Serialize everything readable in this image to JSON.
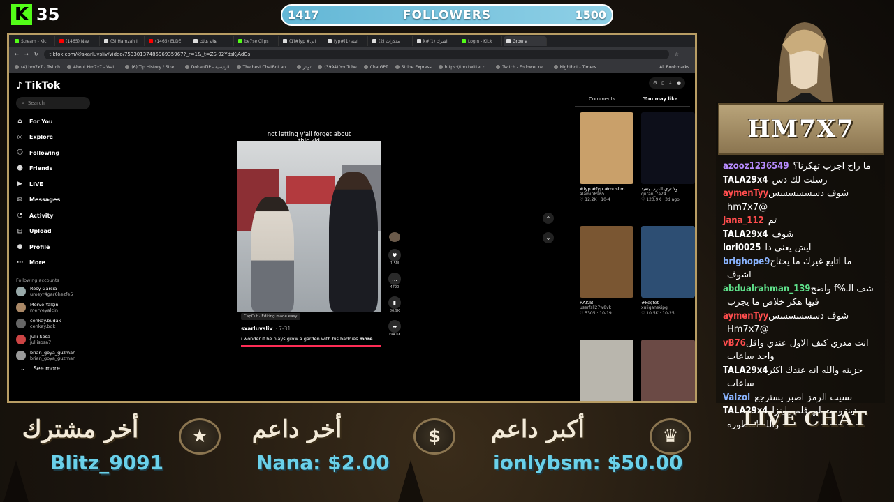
{
  "kick": {
    "logo": "K",
    "count": "35"
  },
  "followers": {
    "current": "1417",
    "label": "FOLLOWERS",
    "goal": "1500",
    "progress_fraction": 0.6
  },
  "browser": {
    "tabs": [
      "Stream - Kic",
      "(1465) Nav",
      "(3) Hamzah I",
      "(1465) ELDE",
      "هاله هالك",
      "be7se Clips",
      "(1)#fyp #اني",
      "fyp#(1) اتبنه",
      "(2) مذكرات",
      "k#الشرك (1)",
      "Login - Kick",
      "Grow a"
    ],
    "url": "tiktok.com/@sxarluvsliv/video/753301374859693596​7?_r=1&_t=ZS-92YdsKjAdGs",
    "bookmarks": [
      "(4) hm7x7 - Twitch",
      "About Hm7x7 - Wat...",
      "(6) Tip History / Stre...",
      "DokanTIP - الرئيسية",
      "The best ChatBot an...",
      "تويتر",
      "(3994) YouTube",
      "ChatGPT",
      "Stripe Express",
      "https://ton.twitter.c...",
      "Twitch - Follower re...",
      "Nightbot - Timers"
    ],
    "all_bookmarks": "All Bookmarks"
  },
  "tiktok": {
    "brand": "TikTok",
    "search_placeholder": "Search",
    "nav": [
      "For You",
      "Explore",
      "Following",
      "Friends",
      "LIVE",
      "Messages",
      "Activity",
      "Upload",
      "Profile",
      "More"
    ],
    "following_title": "Following accounts",
    "accounts": [
      {
        "name": "Rosy Garcia",
        "handle": "urosyr4gar6hezfe5"
      },
      {
        "name": "Merve Yalçın",
        "handle": "merveyalcin"
      },
      {
        "name": "cenkay.budak",
        "handle": "cenkay.bdk"
      },
      {
        "name": "Julii Sosa",
        "handle": "juliisosa7"
      },
      {
        "name": "brian_goya_guzman",
        "handle": "brian_goya_guzman"
      }
    ],
    "see_more": "See more",
    "video": {
      "caption": "not letting y'all forget about this kid",
      "likes": "1.5M",
      "comments": "4720",
      "saves": "86.9K",
      "shares": "194.6K",
      "capcut": "CapCut · Editing made easy",
      "username": "sxarluvsliv",
      "date": "· 7-31",
      "description": "i wonder if he plays grow a garden with his baddies",
      "more": "more"
    },
    "right_tabs": [
      "Comments",
      "You may like"
    ],
    "recommendations": [
      {
        "title": "#fyp #fyp #muslim...",
        "author": "alamin8965",
        "meta": "♡ 12.2K · 10-4",
        "color": "#c9a06a"
      },
      {
        "title": "ولا تري الدرب يتقيد...",
        "author": "quran_7a24",
        "meta": "♡ 120.9K · 3d ago",
        "color": "#0d0f1a"
      },
      {
        "title": "RAKIB",
        "author": "userfsll27w8vk",
        "meta": "♡ 5305 · 10-19",
        "color": "#7a5632"
      },
      {
        "title": "#keşfet",
        "author": "xuliganskipg",
        "meta": "♡ 10.5K · 10-25",
        "color": "#2d4e73"
      },
      {
        "title": "",
        "author": "",
        "meta": "",
        "color": "#b9b6ad"
      },
      {
        "title": "",
        "author": "",
        "meta": "",
        "color": "#6b4a45"
      }
    ]
  },
  "channel": {
    "name": "HM7X7",
    "live_chat": "LIVE CHAT"
  },
  "chat": [
    {
      "user": "azooz1236549",
      "color": "#b88cff",
      "text": "ما راح اجرب تهكرنا؟"
    },
    {
      "user": "TALA29x4",
      "color": "#ffffff",
      "text": "رسلت لك دس"
    },
    {
      "user": "aymenTyy",
      "color": "#ff4d4d",
      "text": "شوف دسسسسسس @hm7x7"
    },
    {
      "user": "Jana_112",
      "color": "#ff4d4d",
      "text": "تم"
    },
    {
      "user": "TALA29x4",
      "color": "#ffffff",
      "text": "شوف"
    },
    {
      "user": "lori0025",
      "color": "#ffffff",
      "text": "ايش يعني ذا"
    },
    {
      "user": "brighope9",
      "color": "#8ab4ff",
      "text": "ما اتابع غيرك ما يحتاج اشوف"
    },
    {
      "user": "abdualrahman_139",
      "color": "#5fe08a",
      "text": "شف الـ%f واضح فيها هكر خلاص ما يجرب"
    },
    {
      "user": "aymenTyy",
      "color": "#ff4d4d",
      "text": "شوف دسسسسسس @Hm7x7"
    },
    {
      "user": "vB76",
      "color": "#ff4d4d",
      "text": "انت مدري كيف الاول عندي واقل واحد ساعات"
    },
    {
      "user": "TALA29x4",
      "color": "#ffffff",
      "text": "حزينه والله انه عندك اكثر ساعات"
    },
    {
      "user": "Vaizol",
      "color": "#8ab4ff",
      "text": "نسيت الرمز اصبر يسترجع"
    },
    {
      "user": "TALA29x4",
      "color": "#ffffff",
      "text": "دينزو بث لي فلم راينزل والله اسطورة"
    }
  ],
  "bottom": {
    "last_sub_label": "أخر مشترك",
    "last_sub_value": "Blitz_9091",
    "last_donor_label": "أخر داعم",
    "last_donor_value": "Nana: $2.00",
    "top_donor_label": "أكبر داعم",
    "top_donor_value": "ionlybsm: $50.00"
  },
  "colors": {
    "accent": "#6ad1ea",
    "frame": "#b89d64",
    "kick": "#53fc18"
  }
}
